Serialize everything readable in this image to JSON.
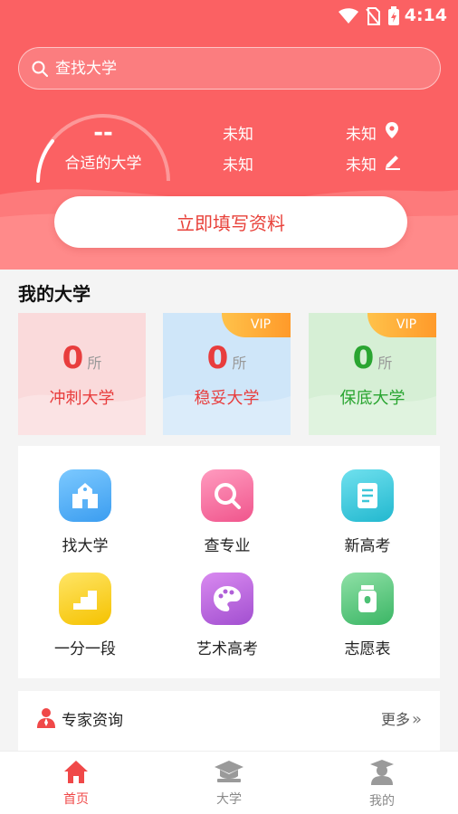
{
  "status_bar": {
    "time": "4:14"
  },
  "search": {
    "placeholder": "查找大学"
  },
  "summary": {
    "value": "--",
    "label": "合适的大学",
    "info_left_top": "未知",
    "info_left_bottom": "未知",
    "info_right_top": "未知",
    "info_right_bottom": "未知"
  },
  "fill_button": {
    "label": "立即填写资料"
  },
  "my_universities": {
    "title": "我的大学",
    "cards": [
      {
        "count": "0",
        "unit": "所",
        "name": "冲刺大学",
        "color": "#e83d3d",
        "bg": "#fadadb",
        "vip": ""
      },
      {
        "count": "0",
        "unit": "所",
        "name": "稳妥大学",
        "color": "#e83d3d",
        "bg": "#cfe6f9",
        "vip": "VIP"
      },
      {
        "count": "0",
        "unit": "所",
        "name": "保底大学",
        "color": "#2aa531",
        "bg": "#d6efd5",
        "vip": "VIP"
      }
    ]
  },
  "features": [
    {
      "label": "找大学",
      "icon": "school-icon"
    },
    {
      "label": "查专业",
      "icon": "magnifier-icon"
    },
    {
      "label": "新高考",
      "icon": "document-icon"
    },
    {
      "label": "一分一段",
      "icon": "steps-icon"
    },
    {
      "label": "艺术高考",
      "icon": "palette-icon"
    },
    {
      "label": "志愿表",
      "icon": "jar-icon"
    }
  ],
  "expert": {
    "title": "专家资询",
    "more": "更多"
  },
  "tabs": [
    {
      "label": "首页",
      "icon": "home-icon",
      "active": true
    },
    {
      "label": "大学",
      "icon": "graduation-cap-icon",
      "active": false
    },
    {
      "label": "我的",
      "icon": "graduate-person-icon",
      "active": false
    }
  ],
  "colors": {
    "brand": "#fb6163",
    "accent_text": "#e8413a",
    "tab_active": "#f04848",
    "tab_inactive": "#8a8a8a"
  }
}
